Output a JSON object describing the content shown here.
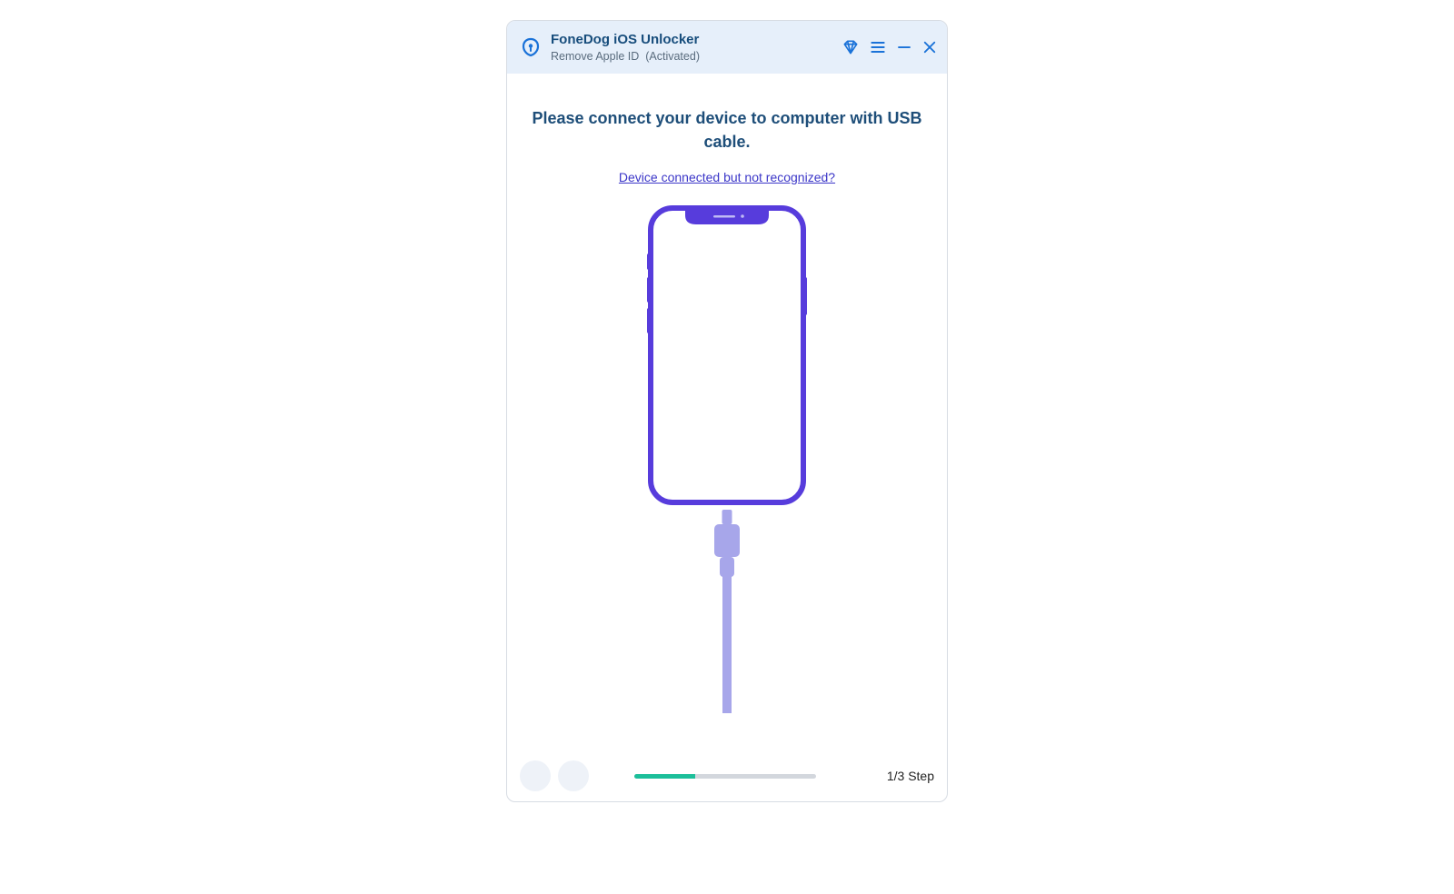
{
  "header": {
    "title": "FoneDog iOS Unlocker",
    "subtitle": "Remove Apple ID",
    "status": "(Activated)"
  },
  "main": {
    "instruction": "Please connect your device to computer with USB cable.",
    "help_link": "Device connected but not recognized?"
  },
  "footer": {
    "step_label": "1/3 Step",
    "progress_percent": 33.3
  },
  "colors": {
    "accent_blue": "#1a72d8",
    "heading": "#1e4e79",
    "link": "#3b36c8",
    "phone_outline": "#573cdc",
    "cable": "#a7a6ea",
    "progress": "#1cbf9a"
  }
}
